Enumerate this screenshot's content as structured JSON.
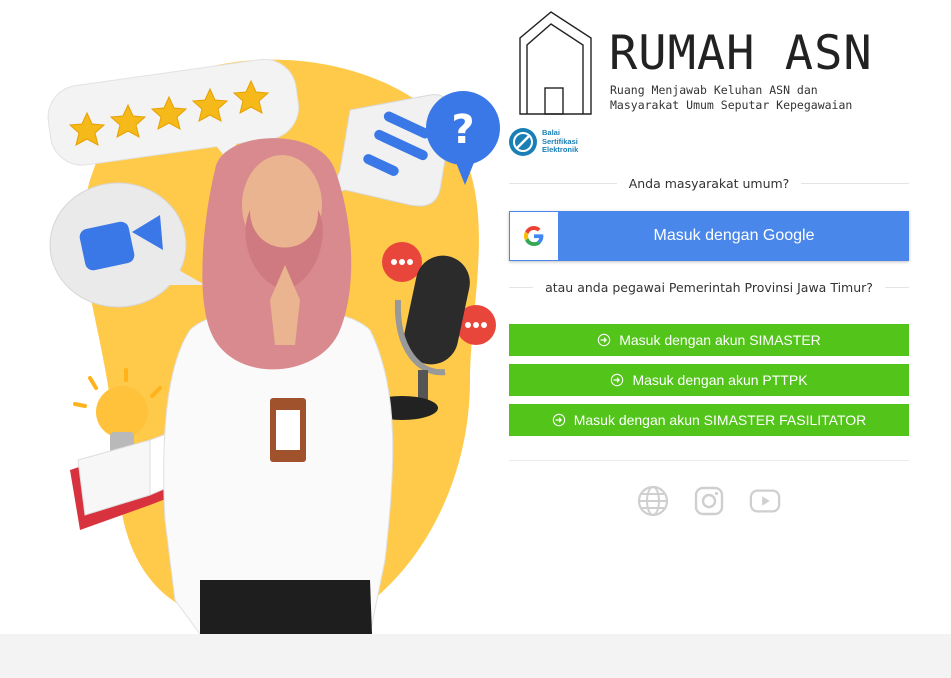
{
  "brand": {
    "title": "RUMAH ASN",
    "subtitle_line1": "Ruang Menjawab Keluhan ASN dan",
    "subtitle_line2": "Masyarakat Umum Seputar Kepegawaian"
  },
  "partner_logo": {
    "line1": "Balai",
    "line2": "Sertifikasi",
    "line3": "Elektronik"
  },
  "public_section": {
    "prompt": "Anda masyarakat umum?",
    "google_button": "Masuk dengan Google"
  },
  "employee_section": {
    "prompt": "atau anda pegawai Pemerintah Provinsi Jawa Timur?",
    "buttons": [
      {
        "label": "Masuk dengan akun SIMASTER"
      },
      {
        "label": "Masuk dengan akun PTTPK"
      },
      {
        "label": "Masuk dengan akun SIMASTER FASILITATOR"
      }
    ]
  },
  "social_icons": [
    "globe-icon",
    "instagram-icon",
    "youtube-icon"
  ],
  "colors": {
    "google_blue": "#4a87ea",
    "green": "#52c41a",
    "hero_yellow": "#ffc94a",
    "footer_gray": "#f3f3f3"
  }
}
